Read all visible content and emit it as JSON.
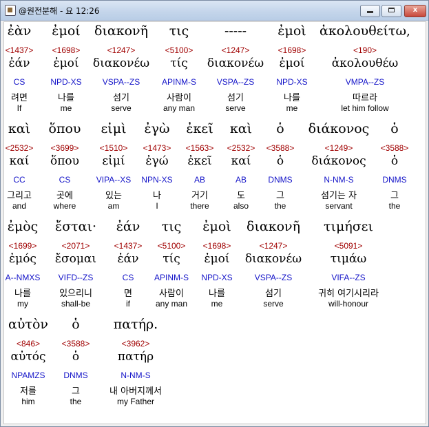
{
  "window": {
    "title": "@원전분해 - 요 12:26",
    "min_label": "",
    "max_label": "",
    "close_label": "x"
  },
  "rows": [
    {
      "words": [
        {
          "greek": "ἐὰν",
          "num": "<1437>",
          "lemma": "ἐάν",
          "morph": "CS",
          "korean": "려면",
          "english": "If"
        },
        {
          "greek": "ἐμοί",
          "num": "<1698>",
          "lemma": "ἐμοί",
          "morph": "NPD-XS",
          "korean": "나를",
          "english": "me"
        },
        {
          "greek": "διακονῆ",
          "num": "<1247>",
          "lemma": "διακονέω",
          "morph": "VSPA--ZS",
          "korean": "섬기",
          "english": "serve"
        },
        {
          "greek": "τις",
          "num": "<5100>",
          "lemma": "τίς",
          "morph": "APINM-S",
          "korean": "사람이",
          "english": "any man"
        },
        {
          "greek": "-----",
          "num": "<1247>",
          "lemma": "διακονέω",
          "morph": "VSPA--ZS",
          "korean": "섬기",
          "english": "serve"
        },
        {
          "greek": "ἐμοὶ",
          "num": "<1698>",
          "lemma": "ἐμοί",
          "morph": "NPD-XS",
          "korean": "나를",
          "english": "me"
        },
        {
          "greek": "ἀκολουθείτω,",
          "num": "<190>",
          "lemma": "ἀκολουθέω",
          "morph": "VMPA--ZS",
          "korean": "따르라",
          "english": "let him follow"
        }
      ]
    },
    {
      "words": [
        {
          "greek": "καὶ",
          "num": "<2532>",
          "lemma": "καί",
          "morph": "CC",
          "korean": "그리고",
          "english": "and"
        },
        {
          "greek": "ὅπου",
          "num": "<3699>",
          "lemma": "ὅπου",
          "morph": "CS",
          "korean": "곳에",
          "english": "where"
        },
        {
          "greek": "εἰμὶ",
          "num": "<1510>",
          "lemma": "εἰμί",
          "morph": "VIPA--XS",
          "korean": "있는",
          "english": "am"
        },
        {
          "greek": "ἐγὼ",
          "num": "<1473>",
          "lemma": "ἐγώ",
          "morph": "NPN-XS",
          "korean": "나",
          "english": "I"
        },
        {
          "greek": "ἐκεῖ",
          "num": "<1563>",
          "lemma": "ἐκεῖ",
          "morph": "AB",
          "korean": "거기",
          "english": "there"
        },
        {
          "greek": "καὶ",
          "num": "<2532>",
          "lemma": "καί",
          "morph": "AB",
          "korean": "도",
          "english": "also"
        },
        {
          "greek": "ὁ",
          "num": "<3588>",
          "lemma": "ὁ",
          "morph": "DNMS",
          "korean": "그",
          "english": "the"
        },
        {
          "greek": "διάκονος",
          "num": "<1249>",
          "lemma": "διάκονος",
          "morph": "N-NM-S",
          "korean": "섬기는 자",
          "english": "servant"
        },
        {
          "greek": "ὁ",
          "num": "<3588>",
          "lemma": "ὁ",
          "morph": "DNMS",
          "korean": "그",
          "english": "the"
        }
      ]
    },
    {
      "words": [
        {
          "greek": "ἐμὸς",
          "num": "<1699>",
          "lemma": "ἐμός",
          "morph": "A--NMXS",
          "korean": "나를",
          "english": "my"
        },
        {
          "greek": "ἔσται·",
          "num": "<2071>",
          "lemma": "ἔσομαι",
          "morph": "VIFD--ZS",
          "korean": "있으리니",
          "english": "shall-be"
        },
        {
          "greek": "ἐάν",
          "num": "<1437>",
          "lemma": "ἐάν",
          "morph": "CS",
          "korean": "면",
          "english": "if"
        },
        {
          "greek": "τις",
          "num": "<5100>",
          "lemma": "τίς",
          "morph": "APINM-S",
          "korean": "사람이",
          "english": "any man"
        },
        {
          "greek": "ἐμοὶ",
          "num": "<1698>",
          "lemma": "ἐμοί",
          "morph": "NPD-XS",
          "korean": "나를",
          "english": "me"
        },
        {
          "greek": "διακονῆ",
          "num": "<1247>",
          "lemma": "διακονέω",
          "morph": "VSPA--ZS",
          "korean": "섬기",
          "english": "serve"
        },
        {
          "greek": "τιμήσει",
          "num": "<5091>",
          "lemma": "τιμάω",
          "morph": "VIFA--ZS",
          "korean": "귀히 여기시리라",
          "english": "will-honour"
        }
      ]
    },
    {
      "words": [
        {
          "greek": "αὐτὸν",
          "num": "<846>",
          "lemma": "αὐτός",
          "morph": "NPAMZS",
          "korean": "저를",
          "english": "him"
        },
        {
          "greek": "ὁ",
          "num": "<3588>",
          "lemma": "ὁ",
          "morph": "DNMS",
          "korean": "그",
          "english": "the"
        },
        {
          "greek": "πατήρ.",
          "num": "<3962>",
          "lemma": "πατήρ",
          "morph": "N-NM-S",
          "korean": "내 아버지께서",
          "english": "my Father"
        }
      ]
    }
  ]
}
